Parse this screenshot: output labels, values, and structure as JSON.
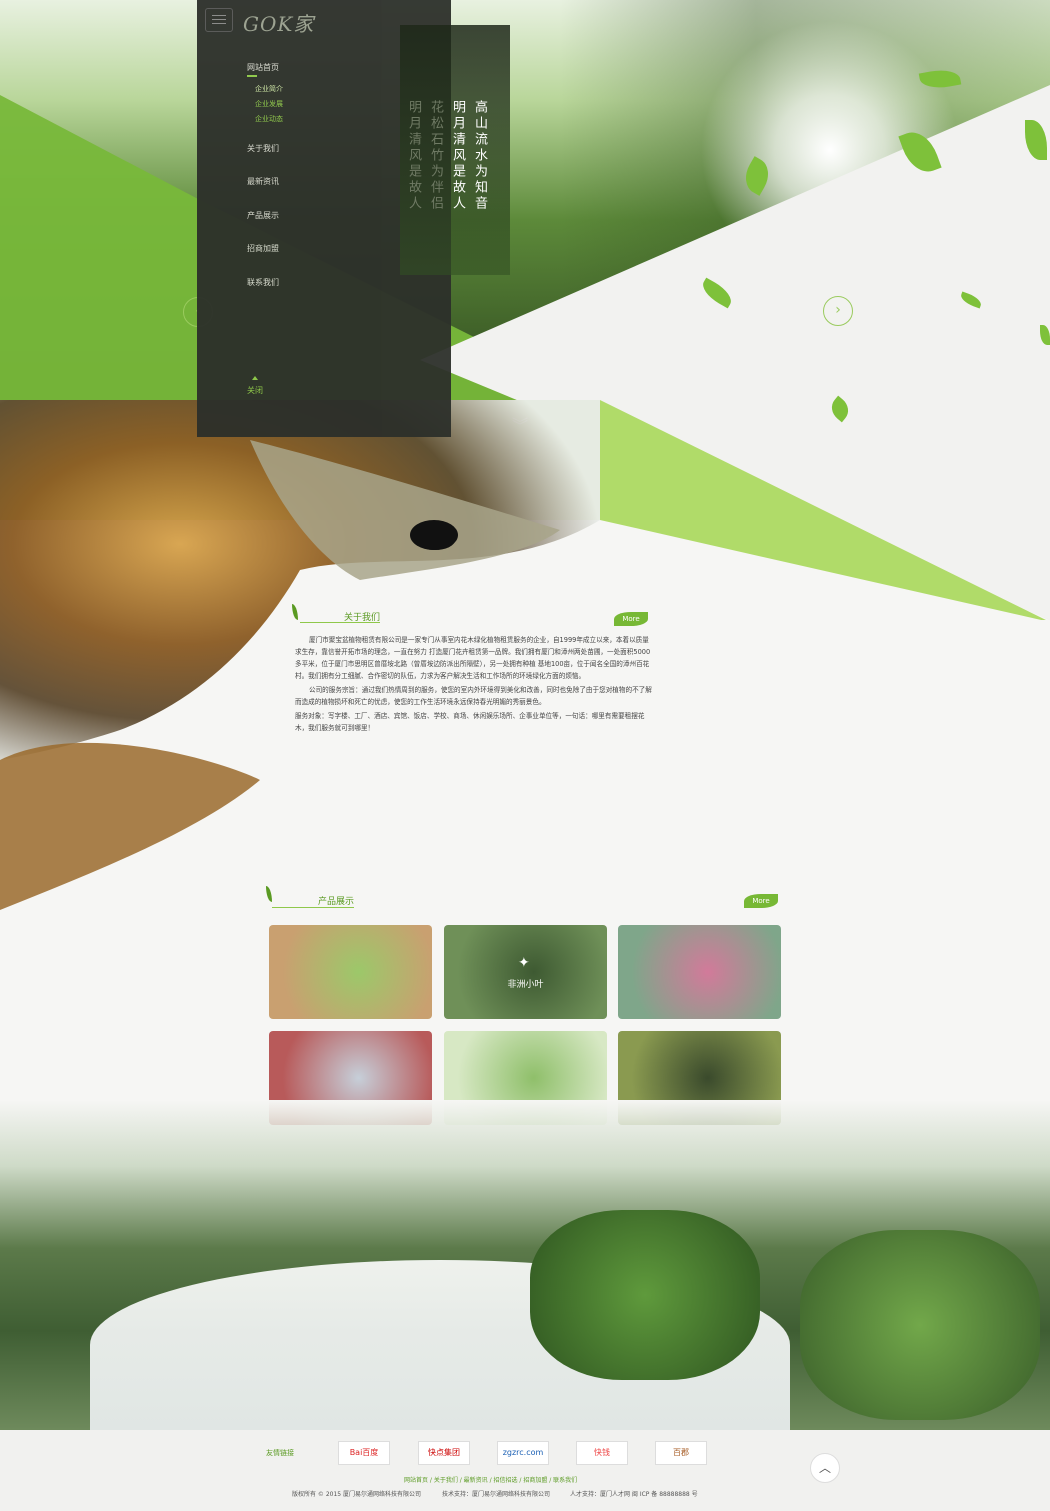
{
  "brand": {
    "logo_text": "GOK家"
  },
  "nav": {
    "items": [
      {
        "label": "网站首页"
      },
      {
        "label": "关于我们"
      },
      {
        "label": "最新资讯"
      },
      {
        "label": "产品展示"
      },
      {
        "label": "招商加盟"
      },
      {
        "label": "联系我们"
      }
    ],
    "subitems": [
      {
        "label": "企业简介"
      },
      {
        "label": "企业发展"
      },
      {
        "label": "企业动态"
      }
    ],
    "close_label": "关闭"
  },
  "poem": {
    "line1": "高山流水为知音",
    "line2": "明月清风是故人",
    "line3": "花松石竹为伴侣",
    "line4": "明月清风是故人"
  },
  "about": {
    "title": "关于我们",
    "more": "More",
    "paragraphs": [
      "厦门市聚宝盆植物租赁有限公司是一家专门从事室内花木绿化植物租赁服务的企业，自1999年成立以来，本着以质量求生存，靠信誉开拓市场的理念，一直在努力 打造厦门花卉租赁第一品牌。我们拥有厦门和漳州两处苗圃，一处面积5000多平米，位于厦门市思明区曾厝垵北路（曾厝垵边防派出所隔壁），另一处拥有种植 基地100亩，位于闻名全国的漳州百花村。我们拥有分工细腻、合作密切的队伍，力求为客户解决生活和工作场所的环境绿化方面的烦恼。",
      "公司的服务宗旨：通过我们热情周到的服务，使您的室内外环境得到美化和改善，同时也免除了由于您对植物的不了解而造成的植物损坏和死亡的忧虑，使您的工作生活环境永远保持春光明媚的秀丽景色。",
      "服务对象：写字楼、工厂、酒店、宾馆、饭店、学校、商场、休闲娱乐场所、企事业单位等，一句话：哪里有需要租摆花木，我们服务就可到哪里！"
    ]
  },
  "products": {
    "title": "产品展示",
    "more": "More",
    "items": [
      {
        "caption": "",
        "c1": "#9cc86a",
        "c2": "#c9a070"
      },
      {
        "caption": "非洲小叶",
        "c1": "#3e5a32",
        "c2": "#6f9058"
      },
      {
        "caption": "",
        "c1": "#d27a9a",
        "c2": "#7fa68a"
      },
      {
        "caption": "",
        "c1": "#c6cfd9",
        "c2": "#b85a5a"
      },
      {
        "caption": "",
        "c1": "#8fbf6a",
        "c2": "#d7e8c4"
      },
      {
        "caption": "",
        "c1": "#3a4a2c",
        "c2": "#8a9a50"
      }
    ]
  },
  "footer": {
    "links_label": "友情链接",
    "logos": [
      {
        "name": "Bai百度"
      },
      {
        "name": "快点集团"
      },
      {
        "name": "zgzrc.com"
      },
      {
        "name": "快钱"
      },
      {
        "name": "百郡"
      }
    ],
    "nav_line": "网站首页 / 关于我们 / 最新资讯 / 招信招选 / 招商加盟 / 联系我们",
    "copyright": "版权所有 © 2015 厦门易尔通网络科技有限公司",
    "tech_support": "技术支持：厦门易尔通网络科技有限公司",
    "talent": "人才支持：厦门人才网 闽 ICP 备 88888888 号"
  },
  "colors": {
    "accent": "#8fc84a",
    "panel": "#2c2f2a",
    "lime": "#b9e26a"
  }
}
